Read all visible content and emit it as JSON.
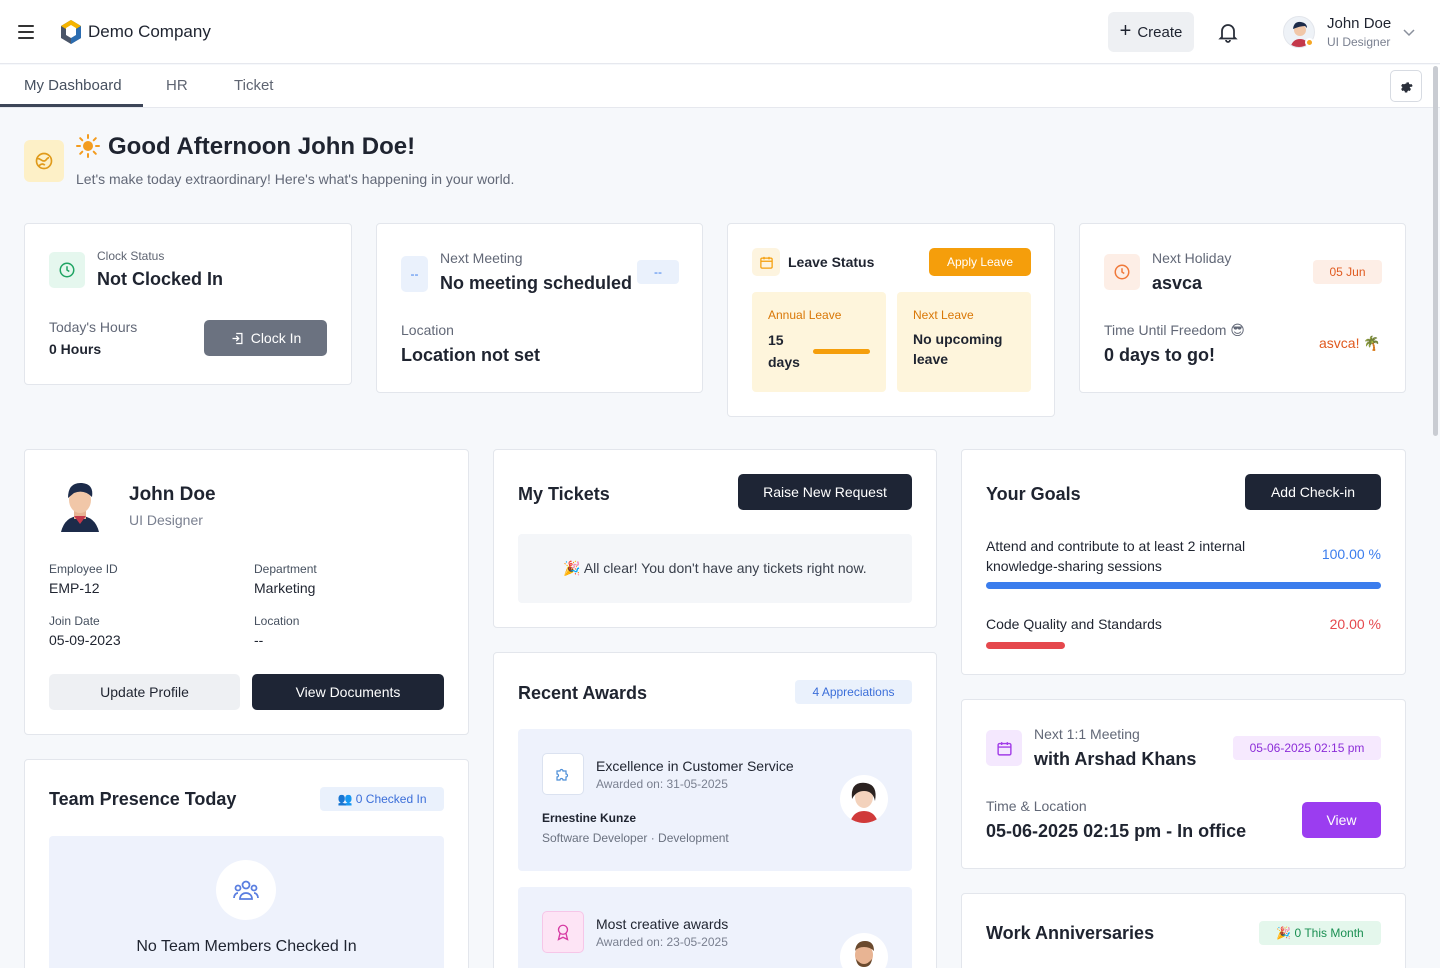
{
  "header": {
    "company": "Demo Company",
    "create_label": "Create",
    "user_name": "John Doe",
    "user_role": "UI Designer"
  },
  "tabs": [
    {
      "label": "My Dashboard"
    },
    {
      "label": "HR"
    },
    {
      "label": "Ticket"
    }
  ],
  "greeting": {
    "title": "Good Afternoon John Doe!",
    "subtitle": "Let's make today extraordinary! Here's what's happening in your world."
  },
  "clock": {
    "label": "Clock Status",
    "status": "Not Clocked In",
    "hours_label": "Today's Hours",
    "hours_value": "0 Hours",
    "button": "Clock In"
  },
  "meeting": {
    "label": "Next Meeting",
    "title": "No meeting scheduled",
    "badge": "--",
    "icon_text": "--",
    "location_label": "Location",
    "location_value": "Location not set"
  },
  "leave": {
    "title": "Leave Status",
    "button": "Apply Leave",
    "annual_label": "Annual Leave",
    "annual_value": "15 days",
    "annual_progress": 1.0,
    "next_label": "Next Leave",
    "next_value": "No upcoming leave"
  },
  "holiday": {
    "label": "Next Holiday",
    "name": "asvca",
    "date_badge": "05 Jun",
    "freedom_label": "Time Until Freedom 😎",
    "freedom_value": "0 days to go!",
    "note": "asvca! 🌴"
  },
  "profile": {
    "name": "John Doe",
    "role": "UI Designer",
    "employee_id_label": "Employee ID",
    "employee_id": "EMP-12",
    "department_label": "Department",
    "department": "Marketing",
    "join_date_label": "Join Date",
    "join_date": "05-09-2023",
    "location_label": "Location",
    "location": "--",
    "update_button": "Update Profile",
    "documents_button": "View Documents"
  },
  "tickets": {
    "title": "My Tickets",
    "button": "Raise New Request",
    "empty": "🎉 All clear! You don't have any tickets right now."
  },
  "goals": {
    "title": "Your Goals",
    "button": "Add Check-in",
    "items": [
      {
        "text": "Attend and contribute to at least 2 internal knowledge-sharing sessions",
        "percent_label": "100.00 %",
        "progress": 1.0,
        "color": "#3b7ded"
      },
      {
        "text": "Code Quality and Standards",
        "percent_label": "20.00 %",
        "progress": 0.2,
        "color": "#e5484d"
      }
    ]
  },
  "team": {
    "title": "Team Presence Today",
    "badge": "👥 0 Checked In",
    "empty": "No Team Members Checked In"
  },
  "awards": {
    "title": "Recent Awards",
    "badge": "4 Appreciations",
    "items": [
      {
        "title": "Excellence in Customer Service",
        "date": "Awarded on: 31-05-2025",
        "person": "Ernestine Kunze",
        "meta": "Software Developer · Development"
      },
      {
        "title": "Most creative awards",
        "date": "Awarded on: 23-05-2025"
      }
    ]
  },
  "one_on_one": {
    "label": "Next 1:1 Meeting",
    "title": "with Arshad Khans",
    "badge": "05-06-2025 02:15 pm",
    "tl_label": "Time & Location",
    "tl_value": "05-06-2025 02:15 pm - In office",
    "button": "View"
  },
  "anniversaries": {
    "title": "Work Anniversaries",
    "badge": "🎉 0 This Month"
  },
  "colors": {
    "accent_dark": "#1e2535",
    "leave_orange": "#f59e0b",
    "purple": "#9b3df0",
    "goal_blue": "#3b7ded",
    "goal_red": "#e5484d"
  }
}
